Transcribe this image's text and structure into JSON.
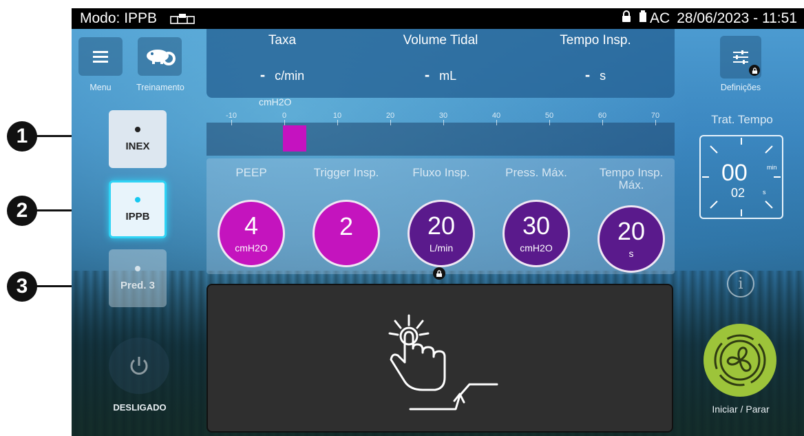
{
  "callouts": [
    "1",
    "2",
    "3"
  ],
  "status": {
    "mode": "Modo: IPPB",
    "power_source": "AC",
    "datetime": "28/06/2023 - 11:51"
  },
  "top_left": {
    "menu_label": "Menu",
    "training_label": "Treinamento"
  },
  "metrics": [
    {
      "title": "Taxa",
      "value": "-",
      "unit": "c/min"
    },
    {
      "title": "Volume Tidal",
      "value": "-",
      "unit": "mL"
    },
    {
      "title": "Tempo Insp.",
      "value": "-",
      "unit": "s"
    }
  ],
  "ruler": {
    "unit": "cmH2O",
    "ticks": [
      "-10",
      "0",
      "10",
      "20",
      "30",
      "40",
      "50",
      "60",
      "70"
    ],
    "marker_value": 0
  },
  "parameters": [
    {
      "label": "PEEP",
      "value": "4",
      "unit": "cmH2O",
      "color": "#c414be"
    },
    {
      "label": "Trigger Insp.",
      "value": "2",
      "unit": "",
      "color": "#c414be"
    },
    {
      "label": "Fluxo Insp.",
      "value": "20",
      "unit": "L/min",
      "color": "#5a1a8c"
    },
    {
      "label": "Press. Máx.",
      "value": "30",
      "unit": "cmH2O",
      "color": "#5a1a8c"
    },
    {
      "label": "Tempo Insp.\nMáx.",
      "value": "20",
      "unit": "s",
      "color": "#5a1a8c"
    }
  ],
  "modes": [
    {
      "label": "INEX",
      "state": "inactive"
    },
    {
      "label": "IPPB",
      "state": "active"
    },
    {
      "label": "Pred. 3",
      "state": "disabled"
    }
  ],
  "power": {
    "label": "DESLIGADO"
  },
  "right": {
    "settings_label": "Definições",
    "timer_title": "Trat. Tempo",
    "timer_minutes": "00",
    "timer_min_unit": "min",
    "timer_seconds": "02",
    "timer_sec_unit": "s",
    "start_label": "Iniciar / Parar"
  },
  "colors": {
    "peep_trigger": "#c414be",
    "other_params": "#5a1a8c",
    "start_button": "#9dc43a",
    "active_mode": "#16c8f0"
  }
}
